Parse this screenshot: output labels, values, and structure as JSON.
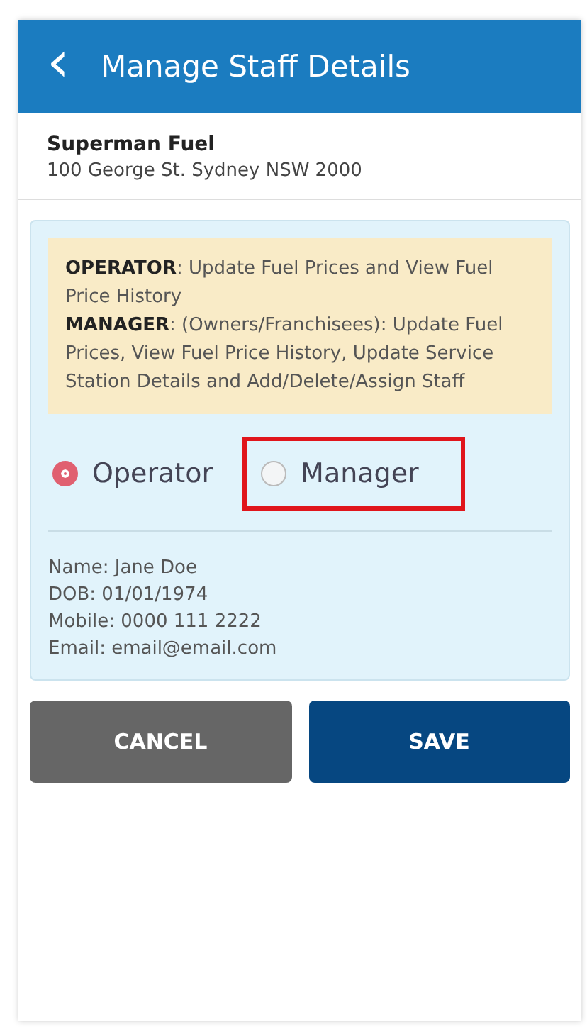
{
  "header": {
    "back_icon": "‹",
    "title": "Manage Staff Details"
  },
  "station": {
    "name": "Superman Fuel",
    "address": "100 George St. Sydney NSW 2000"
  },
  "role_info": [
    "**OPERATOR**: Update Fuel Prices and View Fuel Price History",
    "**MANAGER**: (Owners/Franchisees): Update Fuel Prices, View Fuel Price History, Update Service Station Details and Add/Delete/Assign Staff"
  ],
  "roles": [
    {
      "label": "Operator",
      "selected": true,
      "highlighted": false
    },
    {
      "label": "Manager",
      "selected": false,
      "highlighted": true
    }
  ],
  "details": [
    "Name: Jane Doe",
    "DOB: 01/01/1974",
    "Mobile: 0000 111 2222",
    "Email: email@email.com"
  ],
  "buttons": [
    {
      "label": "CANCEL",
      "kind": "secondary"
    },
    {
      "label": "SAVE",
      "kind": "primary"
    }
  ]
}
